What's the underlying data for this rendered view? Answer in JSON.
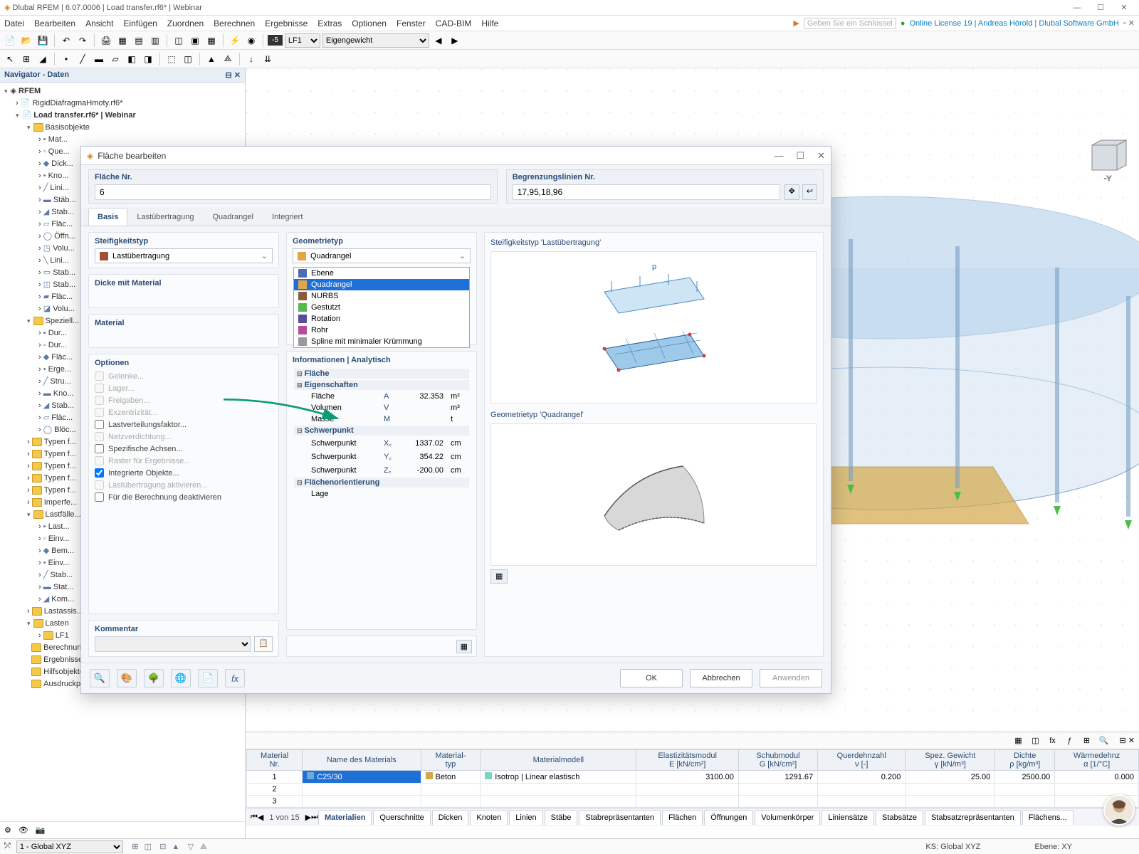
{
  "window": {
    "title": "Dlubal RFEM | 6.07.0006 | Load transfer.rf6* | Webinar",
    "license": "Online License 19 | Andreas Hörold | Dlubal Software GmbH"
  },
  "menu": [
    "Datei",
    "Bearbeiten",
    "Ansicht",
    "Einfügen",
    "Zuordnen",
    "Berechnen",
    "Ergebnisse",
    "Extras",
    "Optionen",
    "Fenster",
    "CAD-BIM",
    "Hilfe"
  ],
  "search_placeholder": "Geben Sie ein Schlüsselwort ein (Alt...",
  "loadcase": {
    "code": "LF1",
    "name": "Eigengewicht"
  },
  "navigator": {
    "title": "Navigator - Daten",
    "root": "RFEM",
    "models": [
      "RigidDiafragmaHmoty.rf6*",
      "Load transfer.rf6* | Webinar"
    ],
    "basis_label": "Basisobjekte",
    "basis": [
      "Mat...",
      "Que...",
      "Dick...",
      "Kno...",
      "Lini...",
      "Stäb...",
      "Stab...",
      "Fläc...",
      "Öffn...",
      "Volu...",
      "Lini...",
      "Stab...",
      "Stab...",
      "Fläc...",
      "Volu..."
    ],
    "special_label": "Speziell...",
    "special": [
      "Dur...",
      "Dur...",
      "Fläc...",
      "Erge...",
      "Stru...",
      "Kno...",
      "Stab...",
      "Fläc...",
      "Blöc..."
    ],
    "type_groups": [
      "Typen f...",
      "Typen f...",
      "Typen f...",
      "Typen f...",
      "Typen f...",
      "Imperfe..."
    ],
    "lastfalle_label": "Lastfälle...",
    "lastfalle": [
      "Last...",
      "Einv...",
      "Bem...",
      "Einv...",
      "Stab...",
      "Stat...",
      "Kom..."
    ],
    "lastassist": "Lastassis...",
    "lasten_label": "Lasten",
    "lasten": [
      "LF1"
    ],
    "bottom": [
      "Berechnungsdiagramme",
      "Ergebnisse",
      "Hilfsobjekte",
      "Ausdruckprotokolle"
    ]
  },
  "dialog": {
    "title": "Fläche bearbeiten",
    "flaeche_nr_label": "Fläche Nr.",
    "flaeche_nr": "6",
    "begrenzung_label": "Begrenzungslinien Nr.",
    "begrenzung": "17,95,18,96",
    "tabs": [
      "Basis",
      "Lastübertragung",
      "Quadrangel",
      "Integriert"
    ],
    "steifigkeit_label": "Steifigkeitstyp",
    "steifigkeit_value": "Lastübertragung",
    "dicke_label": "Dicke mit Material",
    "material_label": "Material",
    "optionen_label": "Optionen",
    "options": [
      {
        "label": "Gelenke...",
        "enabled": false,
        "checked": false
      },
      {
        "label": "Lager...",
        "enabled": false,
        "checked": false
      },
      {
        "label": "Freigaben...",
        "enabled": false,
        "checked": false
      },
      {
        "label": "Exzentrizität...",
        "enabled": false,
        "checked": false
      },
      {
        "label": "Lastverteilungsfaktor...",
        "enabled": true,
        "checked": false
      },
      {
        "label": "Netzverdichtung...",
        "enabled": false,
        "checked": false
      },
      {
        "label": "Spezifische Achsen...",
        "enabled": true,
        "checked": false
      },
      {
        "label": "Raster für Ergebnisse...",
        "enabled": false,
        "checked": false
      },
      {
        "label": "Integrierte Objekte...",
        "enabled": true,
        "checked": true
      },
      {
        "label": "Lastübertragung aktivieren...",
        "enabled": false,
        "checked": false
      },
      {
        "label": "Für die Berechnung deaktivieren",
        "enabled": true,
        "checked": false
      }
    ],
    "geometrie_label": "Geometrietyp",
    "geometrie_value": "Quadrangel",
    "geometrie_options": [
      {
        "label": "Ebene",
        "color": "#4b6cb7"
      },
      {
        "label": "Quadrangel",
        "color": "#e6a545",
        "selected": true
      },
      {
        "label": "NURBS",
        "color": "#8a5b3a"
      },
      {
        "label": "Gestutzt",
        "color": "#56b94d"
      },
      {
        "label": "Rotation",
        "color": "#5b4b9b"
      },
      {
        "label": "Rohr",
        "color": "#b74b9b"
      },
      {
        "label": "Spline mit minimaler Krümmung",
        "color": "#9a9a9a"
      }
    ],
    "info_label": "Informationen | Analytisch",
    "info_groups": [
      {
        "label": "Fläche",
        "rows": []
      },
      {
        "label": "Eigenschaften",
        "rows": [
          {
            "name": "Fläche",
            "sym": "A",
            "val": "32.353",
            "unit": "m²"
          },
          {
            "name": "Volumen",
            "sym": "V",
            "val": "",
            "unit": "m³"
          },
          {
            "name": "Masse",
            "sym": "M",
            "val": "",
            "unit": "t"
          }
        ]
      },
      {
        "label": "Schwerpunkt",
        "rows": [
          {
            "name": "Schwerpunkt",
            "sym": "X꜀",
            "val": "1337.02",
            "unit": "cm"
          },
          {
            "name": "Schwerpunkt",
            "sym": "Y꜀",
            "val": "354.22",
            "unit": "cm"
          },
          {
            "name": "Schwerpunkt",
            "sym": "Z꜀",
            "val": "-200.00",
            "unit": "cm"
          }
        ]
      },
      {
        "label": "Flächenorientierung",
        "rows": [
          {
            "name": "Lage",
            "sym": "",
            "val": "",
            "unit": ""
          }
        ]
      }
    ],
    "preview1_label": "Steifigkeitstyp 'Lastübertragung'",
    "preview2_label": "Geometrietyp 'Quadrangel'",
    "kommentar_label": "Kommentar",
    "buttons": {
      "ok": "OK",
      "cancel": "Abbrechen",
      "apply": "Anwenden"
    }
  },
  "datatable": {
    "headers": [
      "Material\nNr.",
      "Name des Materials",
      "Material-\ntyp",
      "Materialmodell",
      "Elastizitätsmodul\nE [kN/cm²]",
      "Schubmodul\nG [kN/cm²]",
      "Querdehnzahl\nν [-]",
      "Spez. Gewicht\nγ [kN/m³]",
      "Dichte\nρ [kg/m³]",
      "Wärmedehnz\nα [1/°C]"
    ],
    "rows": [
      {
        "nr": "1",
        "name": "C25/30",
        "typ": "Beton",
        "modell": "Isotrop | Linear elastisch",
        "E": "3100.00",
        "G": "1291.67",
        "nu": "0.200",
        "gamma": "25.00",
        "rho": "2500.00",
        "alpha": "0.000"
      },
      {
        "nr": "2"
      },
      {
        "nr": "3"
      }
    ],
    "page": "1 von 15",
    "tabs": [
      "Materialien",
      "Querschnitte",
      "Dicken",
      "Knoten",
      "Linien",
      "Stäbe",
      "Stabrepräsentanten",
      "Flächen",
      "Öffnungen",
      "Volumenkörper",
      "Liniensätze",
      "Stabsätze",
      "Stabsatzrepräsentanten",
      "Flächens..."
    ]
  },
  "status": {
    "cs_label": "1 - Global XYZ",
    "cs": "KS: Global XYZ",
    "ebene": "Ebene: XY"
  }
}
